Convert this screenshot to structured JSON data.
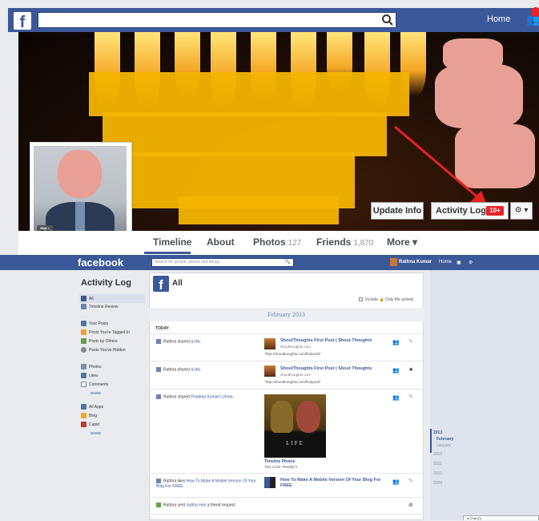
{
  "profile": {
    "fb_logo": "f",
    "nav_home": "Home",
    "update_info_label": "Update Info",
    "activity_log_label": "Activity Log",
    "activity_badge": "10+",
    "tabs": [
      {
        "label": "Timeline",
        "count": ""
      },
      {
        "label": "About",
        "count": ""
      },
      {
        "label": "Photos",
        "count": "127"
      },
      {
        "label": "Friends",
        "count": "1,870"
      },
      {
        "label": "More ▾",
        "count": ""
      }
    ]
  },
  "activity_log": {
    "logo": "facebook",
    "search_placeholder": "Search for people, places and things",
    "user_name": "Rathna Kumar",
    "nav_home": "Home",
    "sidebar_title": "Activity Log",
    "sidebar": {
      "group1": [
        "All",
        "Timeline Review"
      ],
      "group2": [
        "Your Posts",
        "Posts You're Tagged In",
        "Posts by Others",
        "Posts You've Hidden"
      ],
      "group3": [
        "Photos",
        "Likes",
        "Comments"
      ],
      "group4": [
        "All Apps",
        "Bing",
        "Cupid"
      ],
      "more_label": "MORE"
    },
    "header_title": "All",
    "only_me_label": "Include 🔒 Only Me activity",
    "month": "February 2013",
    "today_label": "TODAY",
    "stories": [
      {
        "actor": "Rathna",
        "verb": "shared a ",
        "obj": "link",
        "end": ".",
        "post_title": "ShoutThoughts First Post | Shout Thoughts",
        "post_site": "shoutthoughts.com",
        "post_url": "\"http://shoutthoughts.com/firstpost/\""
      },
      {
        "actor": "Rathna",
        "verb": "shared a ",
        "obj": "link",
        "end": ".",
        "post_title": "ShoutThoughts First Post | Shout Thoughts",
        "post_site": "shoutthoughts.com",
        "post_url": "\"http://shoutthoughts.com/firstpost/\""
      },
      {
        "actor": "Rathna",
        "verb": "shared ",
        "obj": "Pradeep Kumar's photo",
        "end": ".",
        "photo_title": "Timeline Photos",
        "photo_caption": "This is the \"Reality\"!!",
        "poster_text": "LIFE"
      },
      {
        "actor": "Rathna",
        "verb": "likes ",
        "obj": "How To Make A Mobile Version Of Your Blog For FREE",
        "end": ".",
        "post_title": "How To Make A Mobile Version Of Your Blog For FREE"
      },
      {
        "actor": "Rathna",
        "verb": "sent ",
        "obj": "Subha Hari",
        "end": " a friend request."
      }
    ],
    "years": [
      "2013",
      "February",
      "January",
      "2012",
      "2011",
      "2010",
      "2009"
    ],
    "chat_label": "● Chat (0)"
  }
}
